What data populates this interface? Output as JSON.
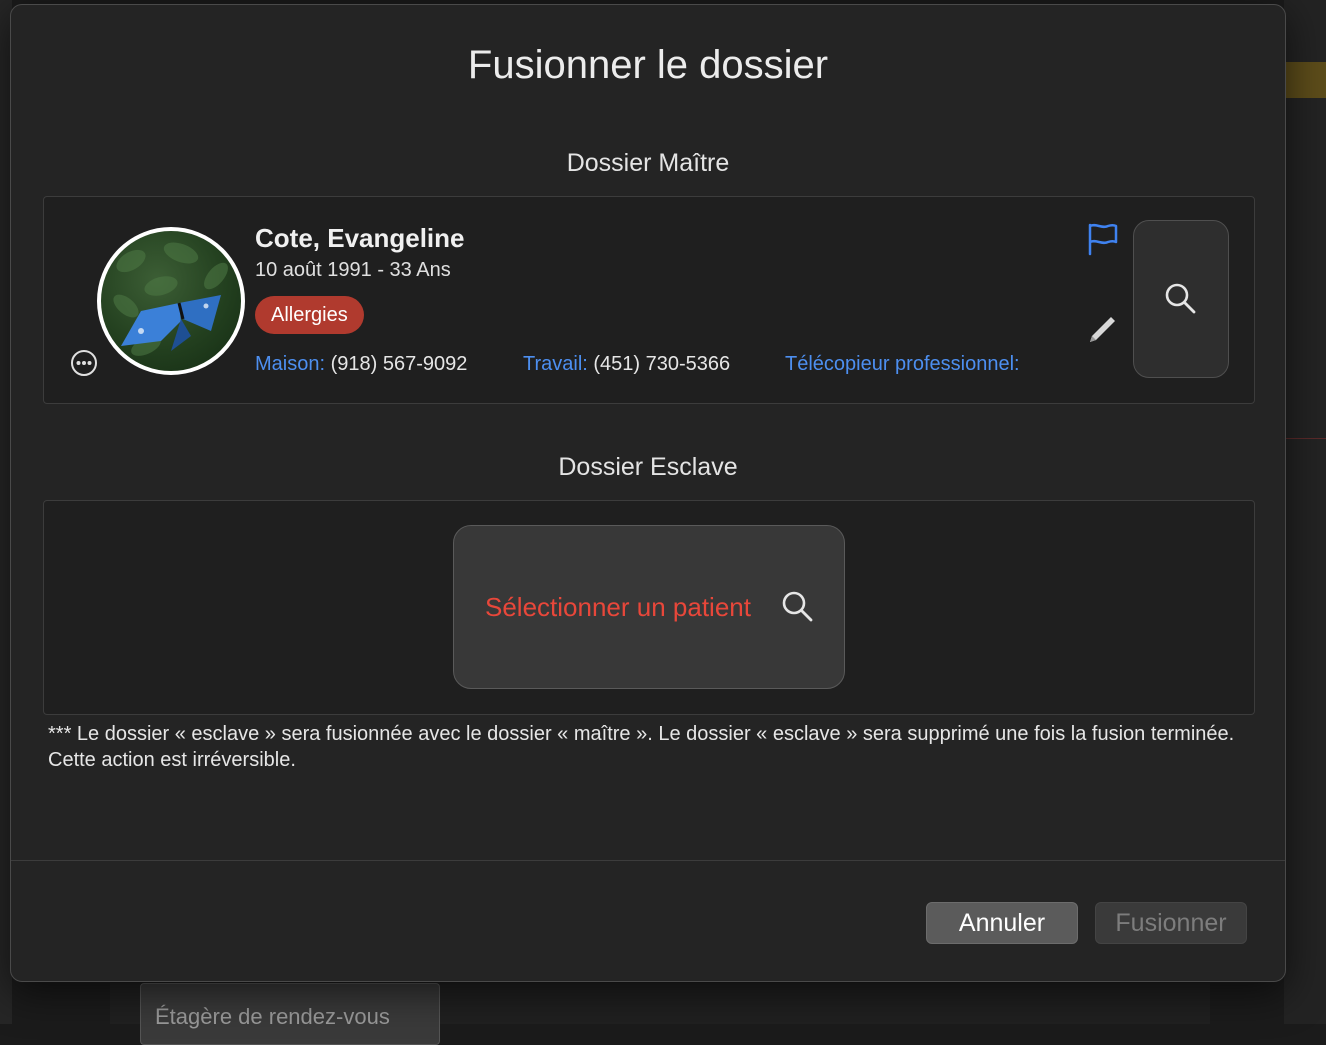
{
  "background": {
    "bottom_tab_label": "Étagère de rendez-vous"
  },
  "dialog": {
    "title": "Fusionner le dossier",
    "master_section_title": "Dossier Maître",
    "slave_section_title": "Dossier Esclave",
    "note": "*** Le dossier « esclave » sera fusionnée avec le dossier « maître ». Le dossier « esclave » sera supprimé une fois la fusion terminée. Cette action est irréversible.",
    "cancel_label": "Annuler",
    "merge_label": "Fusionner"
  },
  "master_patient": {
    "name": "Cote, Evangeline",
    "dob_age": "10 août 1991 - 33 Ans",
    "allergy_badge": "Allergies",
    "home_label": "Maison:",
    "home_phone": "(918) 567-9092",
    "work_label": "Travail:",
    "work_phone": "(451) 730-5366",
    "fax_label": "Télécopieur professionnel:",
    "fax_value": ""
  },
  "slave_patient": {
    "select_label": "Sélectionner un patient"
  },
  "icons": {
    "avatar": "butterfly-photo",
    "more": "ellipsis-circle-icon",
    "flag": "flag-icon",
    "edit": "pencil-icon",
    "search": "search-icon"
  },
  "colors": {
    "accent_blue": "#4d8ff0",
    "allergy_red": "#b03a2e",
    "select_red": "#e8473a"
  }
}
